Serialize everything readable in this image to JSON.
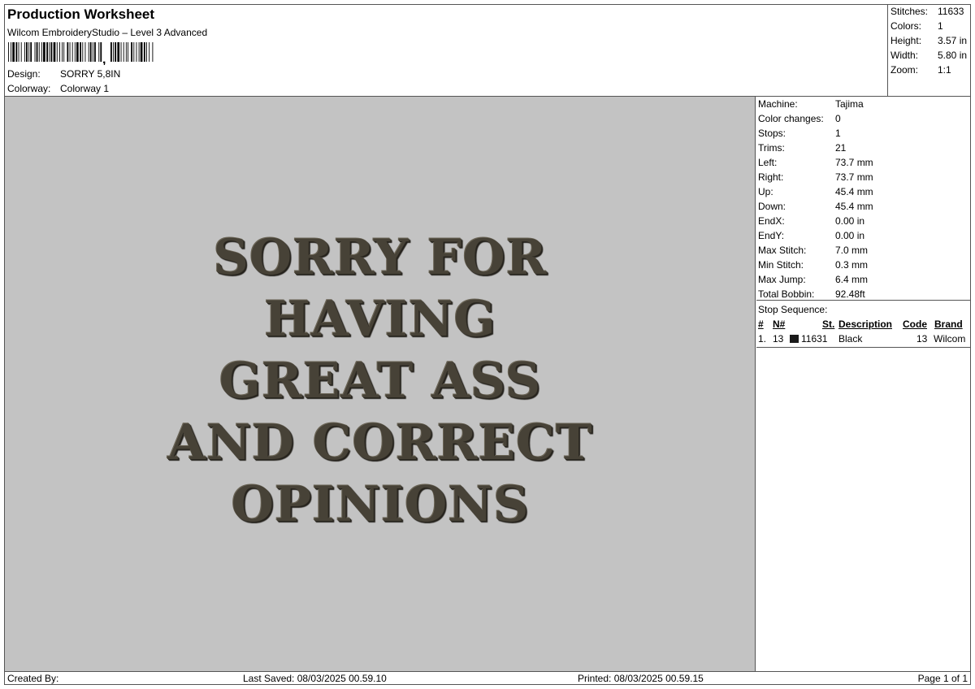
{
  "header": {
    "title": "Production Worksheet",
    "subtitle": "Wilcom EmbroideryStudio – Level 3 Advanced",
    "design_label": "Design:",
    "design_value": "SORRY 5,8IN",
    "colorway_label": "Colorway:",
    "colorway_value": "Colorway 1"
  },
  "summary": {
    "stitches_label": "Stitches:",
    "stitches_value": "11633",
    "colors_label": "Colors:",
    "colors_value": "1",
    "height_label": "Height:",
    "height_value": "3.57 in",
    "width_label": "Width:",
    "width_value": "5.80 in",
    "zoom_label": "Zoom:",
    "zoom_value": "1:1"
  },
  "design": {
    "lines": [
      "SORRY FOR",
      "HAVING",
      "GREAT ASS",
      "AND CORRECT",
      "OPINIONS"
    ],
    "thread_color": "#474237",
    "background_color": "#c3c3c3"
  },
  "stats": {
    "machine_label": "Machine:",
    "machine_value": "Tajima",
    "color_changes_label": "Color changes:",
    "color_changes_value": "0",
    "stops_label": "Stops:",
    "stops_value": "1",
    "trims_label": "Trims:",
    "trims_value": "21",
    "left_label": "Left:",
    "left_value": "73.7 mm",
    "right_label": "Right:",
    "right_value": "73.7 mm",
    "up_label": "Up:",
    "up_value": "45.4 mm",
    "down_label": "Down:",
    "down_value": "45.4 mm",
    "endx_label": "EndX:",
    "endx_value": "0.00 in",
    "endy_label": "EndY:",
    "endy_value": "0.00 in",
    "max_stitch_label": "Max Stitch:",
    "max_stitch_value": "7.0 mm",
    "min_stitch_label": "Min Stitch:",
    "min_stitch_value": "0.3 mm",
    "max_jump_label": "Max Jump:",
    "max_jump_value": "6.4 mm",
    "total_bobbin_label": "Total Bobbin:",
    "total_bobbin_value": "92.48ft"
  },
  "stop_sequence": {
    "title": "Stop Sequence:",
    "headers": {
      "num": "#",
      "n": "N#",
      "st": "St.",
      "description": "Description",
      "code": "Code",
      "brand": "Brand"
    },
    "rows": [
      {
        "num": "1.",
        "n": "13",
        "st": "11631",
        "description": "Black",
        "code": "13",
        "brand": "Wilcom",
        "swatch": "#1a1a1a"
      }
    ]
  },
  "footer": {
    "created_by": "Created By:",
    "last_saved": "Last Saved: 08/03/2025 00.59.10",
    "printed": "Printed: 08/03/2025 00.59.15",
    "page": "Page 1 of 1"
  }
}
